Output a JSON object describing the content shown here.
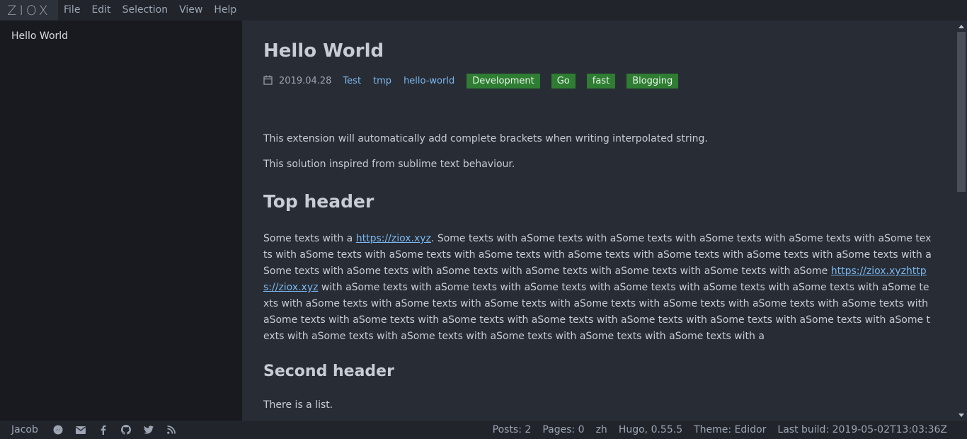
{
  "app": {
    "logo": "ZIOX"
  },
  "menu": [
    "File",
    "Edit",
    "Selection",
    "View",
    "Help"
  ],
  "sidebar": {
    "items": [
      {
        "label": "Hello World"
      }
    ]
  },
  "post": {
    "title": "Hello World",
    "date": "2019.04.28",
    "categories": [
      "Test",
      "tmp",
      "hello-world"
    ],
    "tags": [
      "Development",
      "Go",
      "fast",
      "Blogging"
    ],
    "p1": "This extension will automatically add complete brackets when writing interpolated string.",
    "p2": "This solution inspired from sublime text behaviour.",
    "h_top": "Top header",
    "long_a": "Some texts with a ",
    "link1": "https://ziox.xyz",
    "long_b": ". Some texts with aSome texts with aSome texts with aSome texts with aSome texts with aSome texts with aSome texts with aSome texts with aSome texts with aSome texts with aSome texts with aSome texts with aSome texts with aSome texts with aSome texts with aSome texts with aSome texts with aSome texts with aSome texts with aSome ",
    "link2": "https://ziox.xyzhttps://ziox.xyz",
    "long_c": " with aSome texts with aSome texts with aSome texts with aSome texts with aSome texts with aSome texts with aSome texts with aSome texts with aSome texts with aSome texts with aSome texts with aSome texts with aSome texts with aSome texts with aSome texts with aSome texts with aSome texts with aSome texts with aSome texts with aSome texts with aSome texts with aSome texts with aSome texts with aSome texts with aSome texts with aSome texts with aSome texts with a",
    "h_second": "Second header",
    "list_intro": "There is a list."
  },
  "status": {
    "author": "Jacob",
    "icons": [
      "messenger-icon",
      "mail-icon",
      "facebook-icon",
      "github-icon",
      "twitter-icon",
      "rss-icon"
    ],
    "posts": "Posts: 2",
    "pages": "Pages: 0",
    "lang": "zh",
    "hugo": "Hugo, 0.55.5",
    "theme": "Theme: Edidor",
    "build": "Last build: 2019-05-02T13:03:36Z"
  },
  "colors": {
    "tag_bg": "#2e7d32",
    "link": "#7ab7f0",
    "sidebar_bg": "#181a1f",
    "content_bg": "#282c34"
  }
}
